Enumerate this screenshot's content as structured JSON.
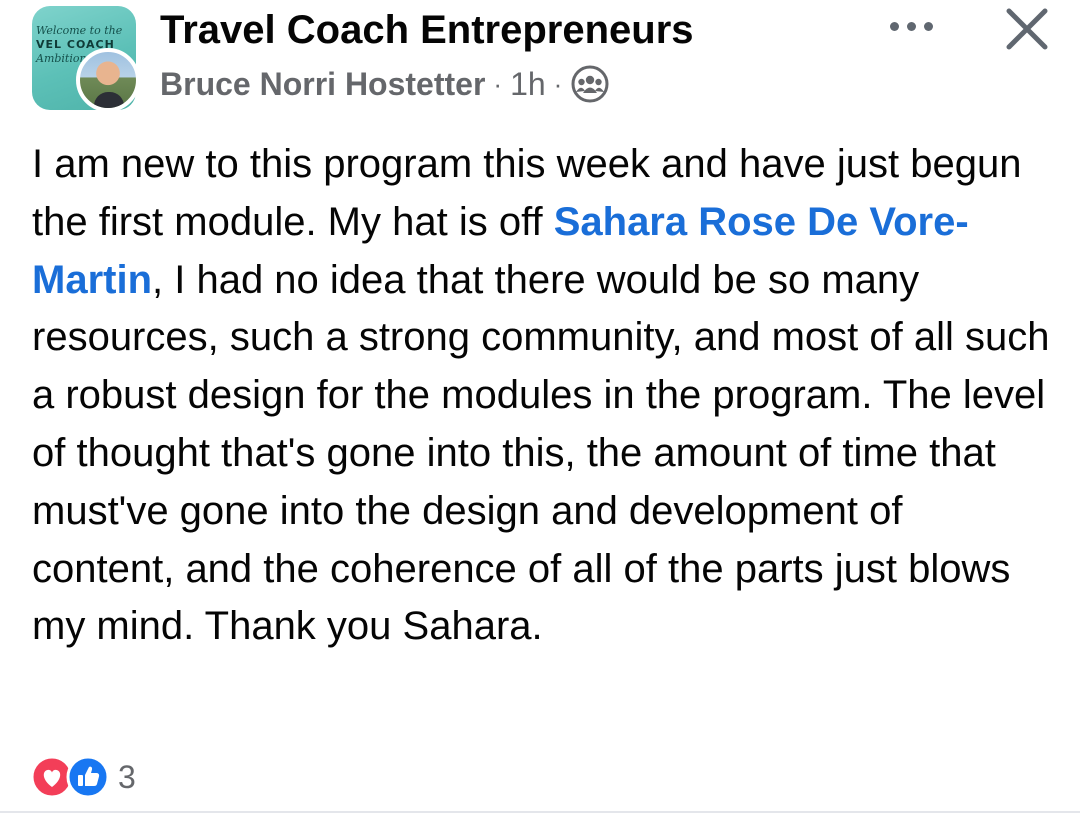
{
  "header": {
    "group_name": "Travel Coach Entrepreneurs",
    "author": "Bruce Norri Hostetter",
    "separator": "·",
    "time": "1h",
    "group_avatar_text": [
      "Welcome to the",
      "VEL COACH",
      "Ambition P"
    ],
    "icons": {
      "audience": "group-icon",
      "more": "more-options-icon",
      "close": "close-icon"
    }
  },
  "post": {
    "text_before_mention": "I am new to this program this week and have just begun the first module. My hat is off ",
    "mention": "Sahara Rose De Vore-Martin",
    "text_after_mention": ", I had no idea that there would be so many resources, such a strong community, and most of all such a robust design for the modules in the program. The level of thought that's gone into this, the amount of time that must've gone into the design and development of content, and the coherence of all of the parts just blows my mind. Thank you Sahara."
  },
  "reactions": {
    "types": [
      "love-reaction-icon",
      "like-reaction-icon"
    ],
    "count": "3"
  },
  "colors": {
    "mention": "#1a6ed8",
    "like": "#1877f2",
    "love": "#f33e58",
    "muted": "#65676b"
  }
}
